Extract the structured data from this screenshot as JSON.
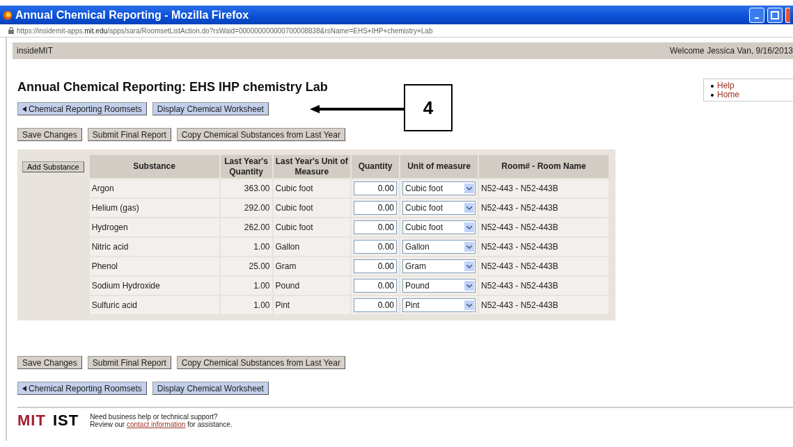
{
  "window": {
    "title": "Annual Chemical Reporting - Mozilla Firefox",
    "url": "https://insidemit-apps.**mit.edu**/apps/sara/RoomsetListAction.do?rsWaid=000000000000700008838&rsName=EHS+IHP+chemistry+Lab"
  },
  "header": {
    "site": "insideMIT",
    "welcome": "Welcome Jessica Van, 9/16/2013"
  },
  "side_links": [
    "Help",
    "Home"
  ],
  "page_title": "Annual Chemical Reporting: EHS IHP chemistry Lab",
  "nav_buttons": [
    {
      "label": "Chemical Reporting Roomsets",
      "kind": "back"
    },
    {
      "label": "Display Chemical Worksheet",
      "kind": "plain"
    }
  ],
  "callout": {
    "label": "4"
  },
  "action_buttons": [
    "Save Changes",
    "Submit Final Report",
    "Copy Chemical Substances from Last Year"
  ],
  "table": {
    "add_button": "Add Substance",
    "columns": [
      "Substance",
      "Last Year's Quantity",
      "Last Year's Unit of Measure",
      "Quantity",
      "Unit of measure",
      "Room# - Room Name"
    ],
    "rows": [
      {
        "substance": "Argon",
        "last_quantity": "363.00",
        "last_unit": "Cubic foot",
        "quantity": "0.00",
        "unit": "Cubic foot",
        "room": "N52-443 - N52-443B"
      },
      {
        "substance": "Helium (gas)",
        "last_quantity": "292.00",
        "last_unit": "Cubic foot",
        "quantity": "0.00",
        "unit": "Cubic foot",
        "room": "N52-443 - N52-443B"
      },
      {
        "substance": "Hydrogen",
        "last_quantity": "262.00",
        "last_unit": "Cubic foot",
        "quantity": "0.00",
        "unit": "Cubic foot",
        "room": "N52-443 - N52-443B"
      },
      {
        "substance": "Nitric acid",
        "last_quantity": "1.00",
        "last_unit": "Gallon",
        "quantity": "0.00",
        "unit": "Gallon",
        "room": "N52-443 - N52-443B"
      },
      {
        "substance": "Phenol",
        "last_quantity": "25.00",
        "last_unit": "Gram",
        "quantity": "0.00",
        "unit": "Gram",
        "room": "N52-443 - N52-443B"
      },
      {
        "substance": "Sodium Hydroxide",
        "last_quantity": "1.00",
        "last_unit": "Pound",
        "quantity": "0.00",
        "unit": "Pound",
        "room": "N52-443 - N52-443B"
      },
      {
        "substance": "Sulfuric acid",
        "last_quantity": "1.00",
        "last_unit": "Pint",
        "quantity": "0.00",
        "unit": "Pint",
        "room": "N52-443 - N52-443B"
      }
    ]
  },
  "bottom_action_buttons": [
    "Save Changes",
    "Submit Final Report",
    "Copy Chemical Substances from Last Year"
  ],
  "bottom_nav_buttons": [
    {
      "label": "Chemical Reporting Roomsets",
      "kind": "back"
    },
    {
      "label": "Display Chemical Worksheet",
      "kind": "plain"
    }
  ],
  "footer": {
    "logos": [
      "MIT",
      "IST"
    ],
    "help_line": "Need business help or technical support?",
    "review_before": "Review our",
    "review_link": "contact information",
    "review_after": "for assistance."
  }
}
